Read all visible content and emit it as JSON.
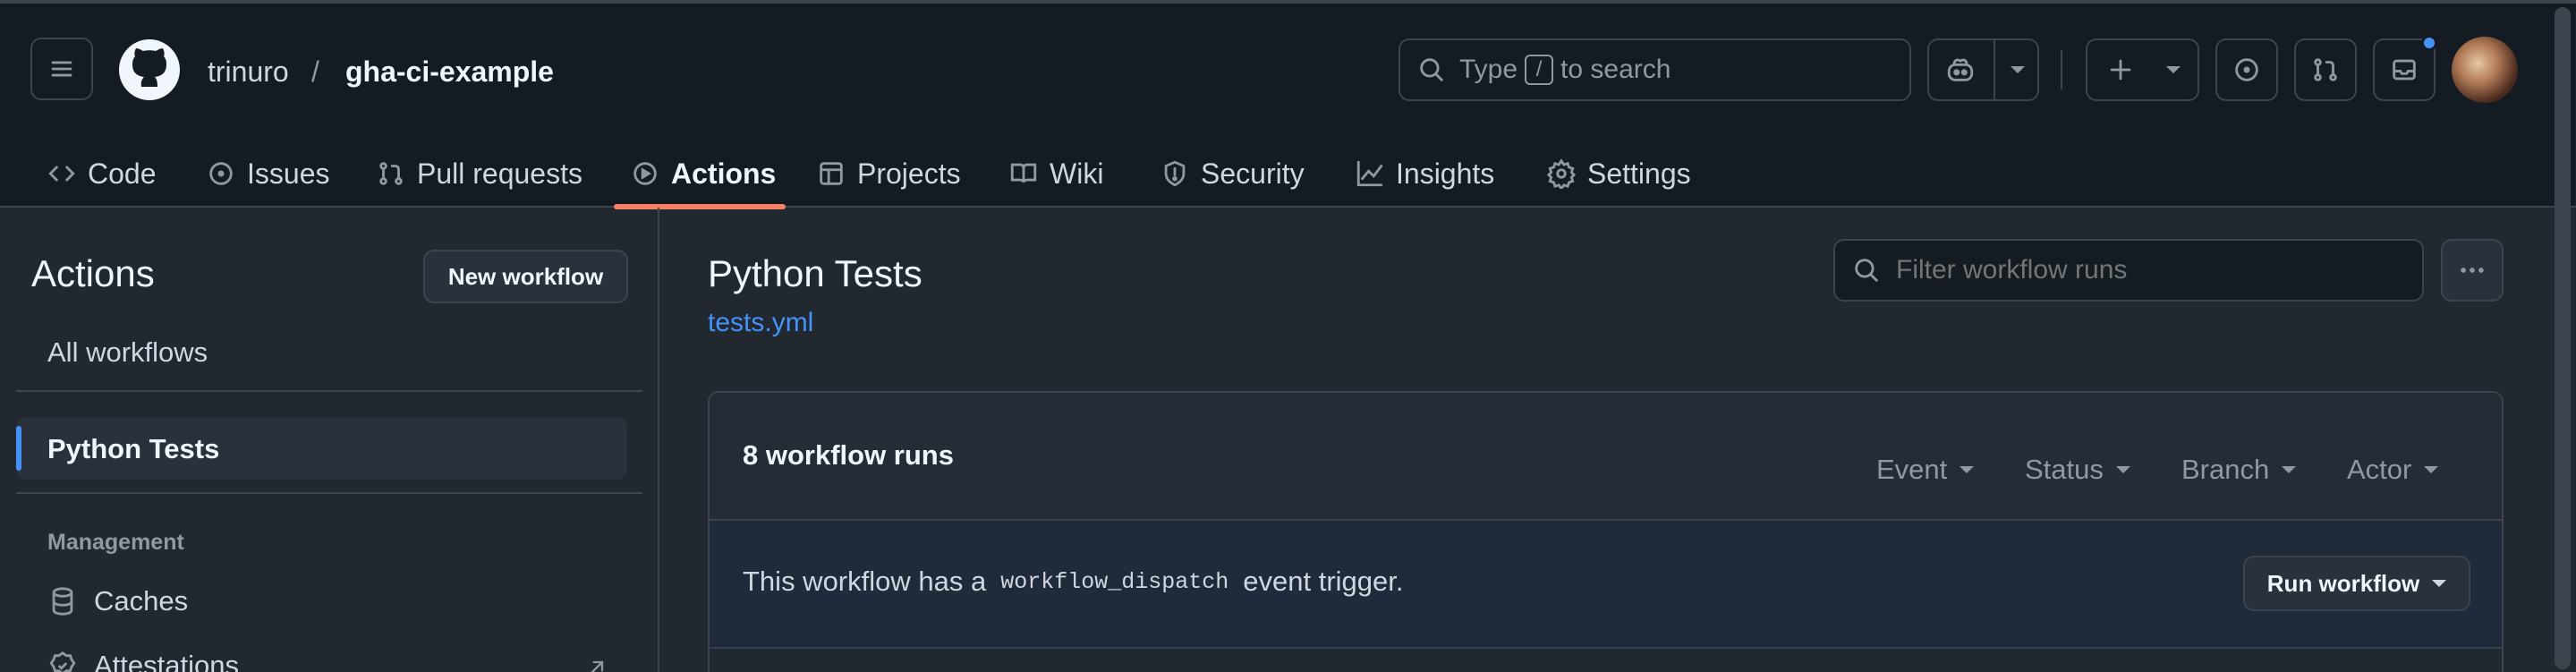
{
  "header": {
    "owner": "trinuro",
    "separator": "/",
    "repo": "gha-ci-example",
    "search": {
      "prefix": "Type",
      "key": "/",
      "suffix": "to search"
    }
  },
  "nav": [
    {
      "label": "Code",
      "icon": "code-icon"
    },
    {
      "label": "Issues",
      "icon": "issue-opened-icon"
    },
    {
      "label": "Pull requests",
      "icon": "git-pull-request-icon"
    },
    {
      "label": "Actions",
      "icon": "play-icon",
      "active": true
    },
    {
      "label": "Projects",
      "icon": "table-icon"
    },
    {
      "label": "Wiki",
      "icon": "book-icon"
    },
    {
      "label": "Security",
      "icon": "shield-icon"
    },
    {
      "label": "Insights",
      "icon": "graph-icon"
    },
    {
      "label": "Settings",
      "icon": "gear-icon"
    }
  ],
  "sidebar": {
    "title": "Actions",
    "new_workflow": "New workflow",
    "all_workflows": "All workflows",
    "selected_workflow": "Python Tests",
    "management_heading": "Management",
    "items": [
      {
        "label": "Caches",
        "icon": "database-icon"
      },
      {
        "label": "Attestations",
        "icon": "verified-icon"
      }
    ]
  },
  "main": {
    "title": "Python Tests",
    "workflow_file": "tests.yml",
    "filter_placeholder": "Filter workflow runs",
    "runs_count": "8 workflow runs",
    "filters": [
      "Event",
      "Status",
      "Branch",
      "Actor"
    ],
    "notice": {
      "before": "This workflow has a",
      "code": "workflow_dispatch",
      "after": "event trigger."
    },
    "run_workflow": "Run workflow"
  },
  "colors": {
    "accent_underline": "#f78166",
    "link": "#4493f8",
    "notification_dot": "#4493f8"
  }
}
